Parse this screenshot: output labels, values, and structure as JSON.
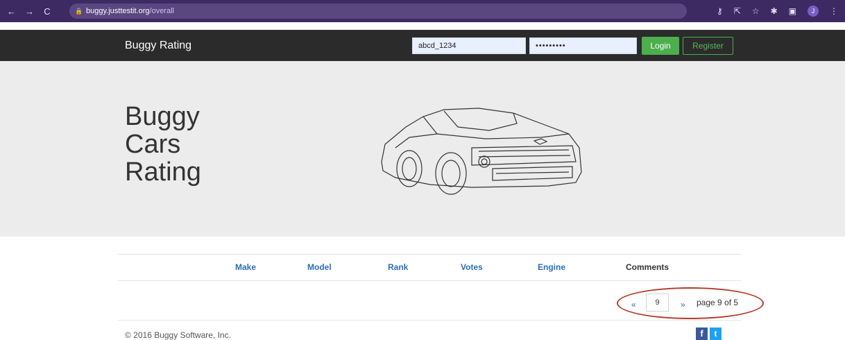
{
  "browser": {
    "url_host": "buggy.justtestit.org",
    "url_path": "/overall",
    "profile_initial": "J"
  },
  "navbar": {
    "brand": "Buggy Rating",
    "username_value": "abcd_1234",
    "password_value": "•••••••••",
    "login_label": "Login",
    "register_label": "Register"
  },
  "hero": {
    "title_line1": "Buggy",
    "title_line2": "Cars",
    "title_line3": "Rating"
  },
  "table": {
    "headers": [
      "Make",
      "Model",
      "Rank",
      "Votes",
      "Engine",
      "Comments"
    ]
  },
  "pager": {
    "prev_label": "«",
    "page_value": "9",
    "next_label": "»",
    "status_text": "page 9 of 5"
  },
  "footer": {
    "copyright": "© 2016 Buggy Software, Inc.",
    "facebook_glyph": "f",
    "twitter_glyph": "t"
  },
  "colors": {
    "chrome_bg": "#3d2a63",
    "navbar_bg": "#2b2b2b",
    "accent_green": "#4cae4c",
    "link_blue": "#2a6ebb",
    "annotation_red": "#b53a2a"
  }
}
